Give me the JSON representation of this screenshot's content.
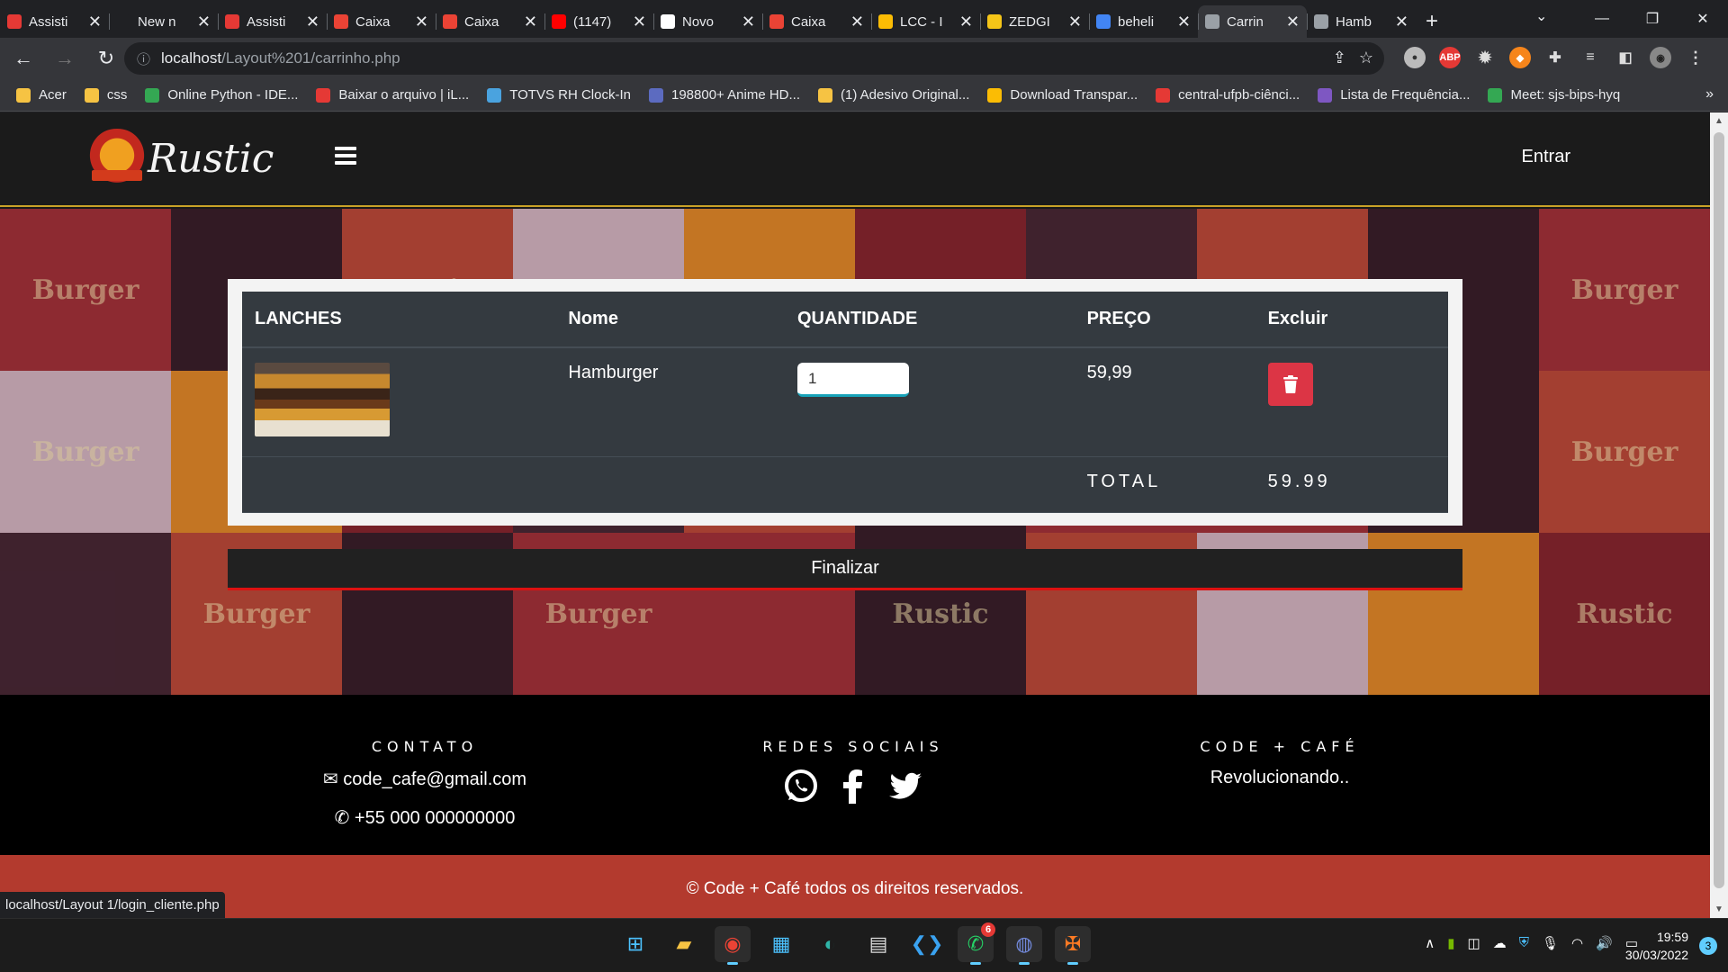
{
  "browser": {
    "tabs": [
      {
        "title": "Assisti",
        "color": "#e53935"
      },
      {
        "title": "New n",
        "color": "#202124"
      },
      {
        "title": "Assisti",
        "color": "#e53935"
      },
      {
        "title": "Caixa",
        "color": "#ea4335"
      },
      {
        "title": "Caixa",
        "color": "#ea4335"
      },
      {
        "title": "(1147)",
        "color": "#ff0000"
      },
      {
        "title": "Novo",
        "color": "#ffffff"
      },
      {
        "title": "Caixa",
        "color": "#ea4335"
      },
      {
        "title": "LCC - I",
        "color": "#fbbc04"
      },
      {
        "title": "ZEDGI",
        "color": "#f5c518"
      },
      {
        "title": "beheli",
        "color": "#4285f4"
      },
      {
        "title": "Carrin",
        "color": "#9aa0a6",
        "active": true
      },
      {
        "title": "Hamb",
        "color": "#9aa0a6"
      }
    ],
    "close_glyph": "✕",
    "new_tab": "+",
    "url_host": "localhost",
    "url_path": "/Layout%201/carrinho.php",
    "bookmarks": [
      {
        "label": "Acer",
        "color": "#f6c343"
      },
      {
        "label": "css",
        "color": "#f6c343"
      },
      {
        "label": "Online Python - IDE...",
        "color": "#34a853"
      },
      {
        "label": "Baixar o arquivo | iL...",
        "color": "#e53935"
      },
      {
        "label": "TOTVS RH Clock-In",
        "color": "#4aa3df"
      },
      {
        "label": "198800+ Anime HD...",
        "color": "#5c6bc0"
      },
      {
        "label": "(1) Adesivo Original...",
        "color": "#f6c343"
      },
      {
        "label": "Download Transpar...",
        "color": "#fbbc04"
      },
      {
        "label": "central-ufpb-ciênci...",
        "color": "#e53935"
      },
      {
        "label": "Lista de Frequência...",
        "color": "#7e57c2"
      },
      {
        "label": "Meet: sjs-bips-hyq",
        "color": "#34a853"
      }
    ],
    "status_url": "localhost/Layout 1/login_cliente.php"
  },
  "site": {
    "logo_text": "Rustic",
    "login_label": "Entrar",
    "bg_tiles": [
      "Burger",
      "",
      "Rustic",
      "Burger",
      "Burger",
      "",
      "Burger",
      "",
      "",
      "Burger",
      "Burger",
      "",
      "",
      "",
      "",
      "",
      "",
      "",
      "",
      "Burger",
      "",
      "Burger",
      "",
      "Burger",
      "",
      "Rustic",
      "",
      "",
      "",
      "Rustic"
    ]
  },
  "cart": {
    "columns": [
      "LANCHES",
      "Nome",
      "QUANTIDADE",
      "PREÇO",
      "Excluir"
    ],
    "items": [
      {
        "name": "Hamburger",
        "quantity": "1",
        "price": "59,99"
      }
    ],
    "total_label": "TOTAL",
    "total_value": "59.99",
    "finalize_label": "Finalizar"
  },
  "footer": {
    "contact_title": "CONTATO",
    "email": "code_cafe@gmail.com",
    "phone": "+55 000 000000000",
    "social_title": "REDES SOCIAIS",
    "brand_title": "CODE + CAFÉ",
    "brand_tagline": "Revolucionando..",
    "copyright": "© Code + Café todos os direitos reservados."
  },
  "taskbar": {
    "time": "19:59",
    "date": "30/03/2022",
    "whatsapp_badge": "6",
    "notifications": "3"
  },
  "colors": {
    "accent_red": "#dc3545",
    "input_focus": "#17a2b8",
    "header_border": "#c9a227"
  }
}
